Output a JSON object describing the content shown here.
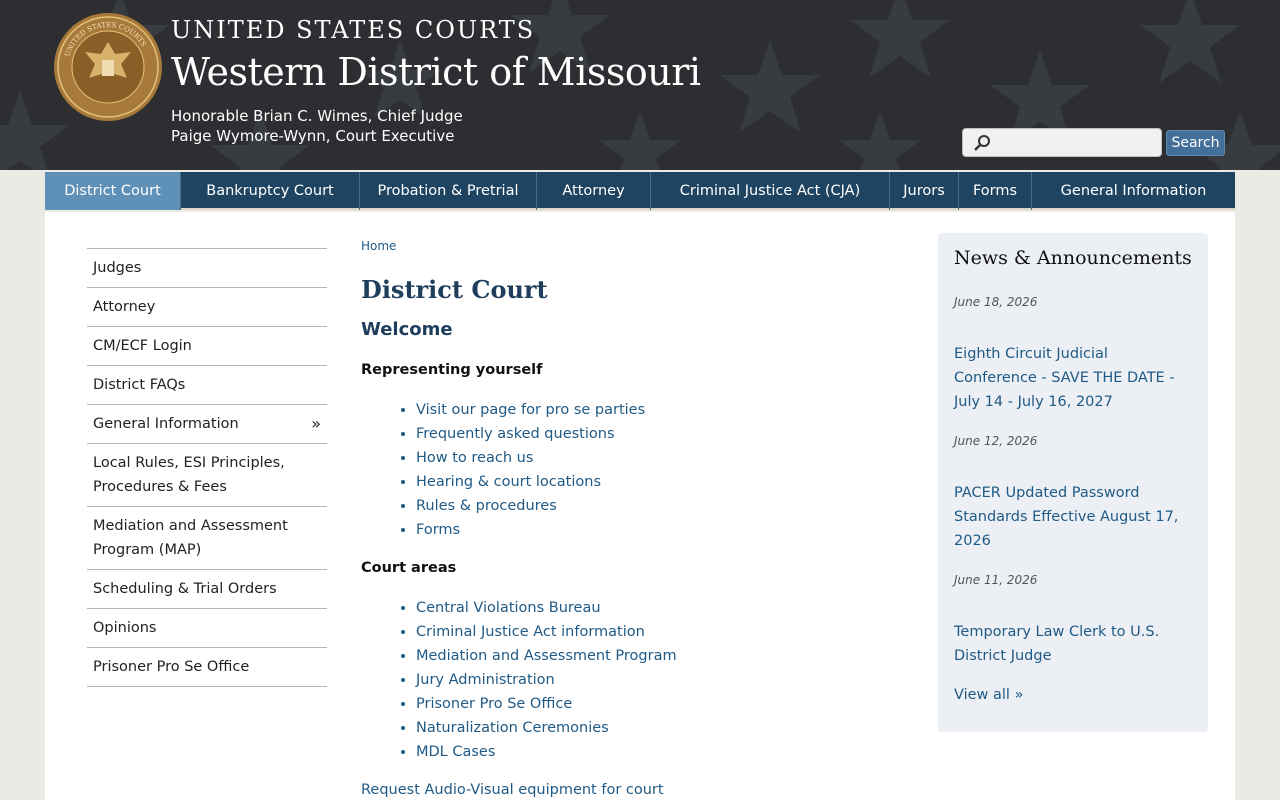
{
  "header": {
    "title_top": "UNITED STATES COURTS",
    "title_main": "Western District of Missouri",
    "subtitle_line1": "Honorable Brian C. Wimes, Chief Judge",
    "subtitle_line2": "Paige Wymore-Wynn, Court Executive",
    "seal_text": "UNITED STATES COURTS · WESTERN DISTRICT OF MISSOURI"
  },
  "search": {
    "placeholder": "",
    "button_label": "Search"
  },
  "nav": {
    "items": [
      {
        "label": "District Court",
        "active": true
      },
      {
        "label": "Bankruptcy Court"
      },
      {
        "label": "Probation & Pretrial"
      },
      {
        "label": "Attorney"
      },
      {
        "label": "Criminal Justice Act (CJA)"
      },
      {
        "label": "Jurors"
      },
      {
        "label": "Forms"
      },
      {
        "label": "General Information"
      }
    ]
  },
  "sidebar": {
    "items": [
      {
        "label": "Judges"
      },
      {
        "label": "Attorney"
      },
      {
        "label": "CM/ECF Login"
      },
      {
        "label": "District FAQs"
      },
      {
        "label": "General Information",
        "arrow": "»"
      },
      {
        "label": "Local Rules, ESI Principles, Procedures & Fees"
      },
      {
        "label": "Mediation and Assessment Program (MAP)"
      },
      {
        "label": "Scheduling & Trial Orders"
      },
      {
        "label": "Opinions"
      },
      {
        "label": "Prisoner Pro Se Office"
      }
    ]
  },
  "main": {
    "breadcrumb": "Home",
    "page_title": "District Court",
    "welcome": "Welcome",
    "section1_heading": "Representing yourself",
    "section1_links": [
      "Visit our page for pro se parties",
      "Frequently asked questions",
      "How to reach us",
      "Hearing & court locations",
      "Rules & procedures",
      "Forms"
    ],
    "section2_heading": "Court areas",
    "section2_links": [
      "Central Violations Bureau",
      "Criminal Justice Act information",
      "Mediation and Assessment Program",
      "Jury Administration",
      "Prisoner Pro Se Office",
      "Naturalization Ceremonies",
      "MDL Cases"
    ],
    "av_link": "Request Audio-Visual equipment for court"
  },
  "news": {
    "title": "News & Announcements",
    "items": [
      {
        "date": "June 18, 2026",
        "link": "Eighth Circuit Judicial Conference - SAVE THE DATE - July 14 - July 16, 2027"
      },
      {
        "date": "June 12, 2026",
        "link": "PACER Updated Password Standards Effective August 17, 2026"
      },
      {
        "date": "June 11, 2026",
        "link": "Temporary Law Clerk to U.S. District Judge"
      }
    ],
    "view_all": "View all »"
  },
  "colors": {
    "header_bg": "#2c2e31",
    "nav_bg": "#1e4461",
    "nav_active": "#5f90b8",
    "link": "#205a86",
    "news_bg": "#ecf0f4"
  }
}
